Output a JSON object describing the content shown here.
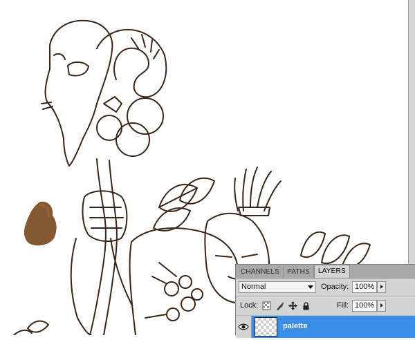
{
  "panel": {
    "tabs": [
      {
        "label": "CHANNELS"
      },
      {
        "label": "PATHS"
      },
      {
        "label": "LAYERS",
        "active": true
      }
    ],
    "blend_mode": "Normal",
    "opacity_label": "Opacity:",
    "opacity_value": "100%",
    "lock_label": "Lock:",
    "fill_label": "Fill:",
    "fill_value": "100%",
    "lock_icons": [
      "lock-transparent-pixels-icon",
      "lock-image-pixels-icon",
      "lock-position-icon",
      "lock-all-icon"
    ],
    "layers": [
      {
        "name": "palette",
        "visible": true,
        "selected": true
      }
    ]
  },
  "colors": {
    "panel_bg": "#d4d4d4",
    "tab_bar": "#a9a9a9",
    "selection": "#3a8ee6",
    "ink": "#3a2418",
    "brush_blob": "#7a4a22"
  }
}
